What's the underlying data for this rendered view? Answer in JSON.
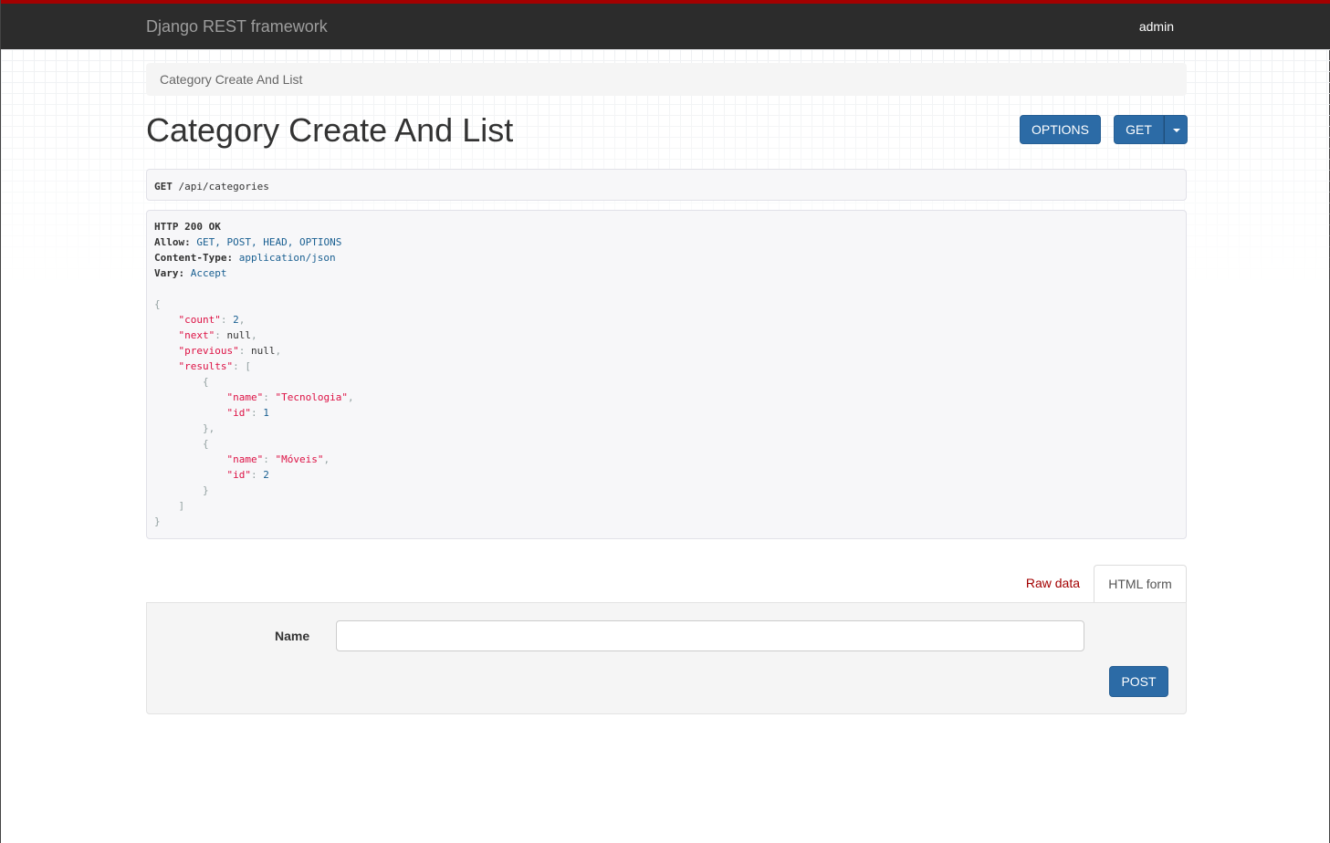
{
  "navbar": {
    "brand": "Django REST framework",
    "user": "admin"
  },
  "colors": {
    "accent": "#a30000",
    "navbar_bg": "#2c2c2c",
    "button_primary": "#2c6ba6"
  },
  "breadcrumb": {
    "label": "Category Create And List"
  },
  "page": {
    "title": "Category Create And List"
  },
  "buttons": {
    "options": "OPTIONS",
    "get": "GET",
    "post": "POST"
  },
  "request": {
    "method": "GET",
    "path": " /api/categories"
  },
  "response": {
    "status": "HTTP 200 OK",
    "headers": [
      {
        "key": "Allow:",
        "value": "GET, POST, HEAD, OPTIONS"
      },
      {
        "key": "Content-Type:",
        "value": "application/json"
      },
      {
        "key": "Vary:",
        "value": "Accept"
      }
    ],
    "body": {
      "count": "2",
      "next": "null",
      "previous": "null",
      "results": [
        {
          "name": "\"Tecnologia\"",
          "id": "1"
        },
        {
          "name": "\"Móveis\"",
          "id": "2"
        }
      ]
    }
  },
  "tabs": {
    "raw": "Raw data",
    "html": "HTML form"
  },
  "form": {
    "name_label": "Name",
    "name_value": ""
  }
}
